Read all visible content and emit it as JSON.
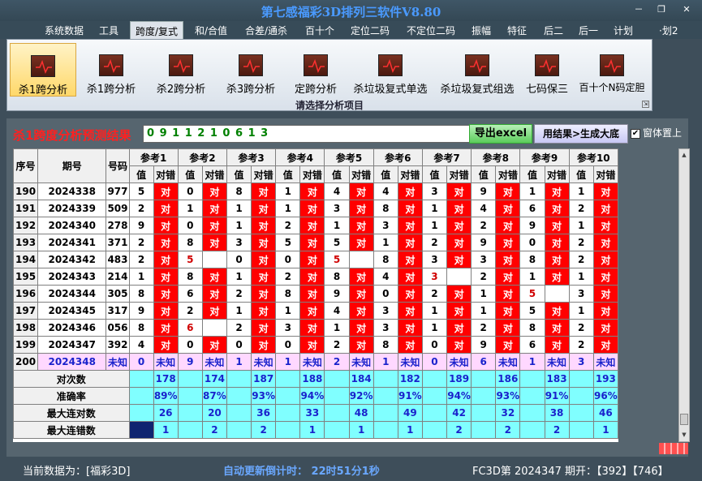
{
  "app": {
    "title": "第七感福彩3D排列三软件V8.80",
    "window_controls": [
      "－",
      "❐",
      "✕"
    ]
  },
  "menu": {
    "items": [
      "系统数据",
      "工具",
      "跨度/复式",
      "和/合值",
      "合差/通杀",
      "百十个",
      "定位二码",
      "不定位二码",
      "振幅",
      "特征",
      "后二",
      "后一",
      "计划",
      "·划2"
    ],
    "active": "跨度/复式"
  },
  "ribbon": {
    "caption": "请选择分析项目",
    "items": [
      "杀1跨分析",
      "杀1跨分析",
      "杀2跨分析",
      "杀3跨分析",
      "定跨分析",
      "杀垃圾复式单选",
      "杀垃圾复式组选",
      "七码保三",
      "百十个N码定胆"
    ],
    "selected_index": 0,
    "icon": "chart-icon"
  },
  "result": {
    "title": "杀1跨度分析预测结果",
    "value": "0 9 1 1 2 1 0 6 1 3",
    "export_button": "导出excel",
    "bigbase_button": "用结果>生成大底",
    "topmost_label": "窗体置上",
    "topmost_checked": true
  },
  "grid": {
    "headers": {
      "seq": "序号",
      "period": "期号",
      "number": "号码",
      "value": "值",
      "match": "对错"
    },
    "refs": [
      "参考1",
      "参考2",
      "参考3",
      "参考4",
      "参考5",
      "参考6",
      "参考7",
      "参考8",
      "参考9",
      "参考10"
    ],
    "rows": [
      {
        "seq": "190",
        "period": "2024338",
        "num": "977",
        "cells": [
          [
            "5",
            "对"
          ],
          [
            "0",
            "对"
          ],
          [
            "8",
            "对"
          ],
          [
            "1",
            "对"
          ],
          [
            "4",
            "对"
          ],
          [
            "4",
            "对"
          ],
          [
            "3",
            "对"
          ],
          [
            "9",
            "对"
          ],
          [
            "1",
            "对"
          ],
          [
            "1",
            "对"
          ]
        ]
      },
      {
        "seq": "191",
        "period": "2024339",
        "num": "509",
        "cells": [
          [
            "2",
            "对"
          ],
          [
            "1",
            "对"
          ],
          [
            "1",
            "对"
          ],
          [
            "1",
            "对"
          ],
          [
            "3",
            "对"
          ],
          [
            "8",
            "对"
          ],
          [
            "1",
            "对"
          ],
          [
            "4",
            "对"
          ],
          [
            "6",
            "对"
          ],
          [
            "2",
            "对"
          ]
        ]
      },
      {
        "seq": "192",
        "period": "2024340",
        "num": "278",
        "cells": [
          [
            "9",
            "对"
          ],
          [
            "0",
            "对"
          ],
          [
            "1",
            "对"
          ],
          [
            "2",
            "对"
          ],
          [
            "1",
            "对"
          ],
          [
            "3",
            "对"
          ],
          [
            "1",
            "对"
          ],
          [
            "2",
            "对"
          ],
          [
            "9",
            "对"
          ],
          [
            "1",
            "对"
          ]
        ]
      },
      {
        "seq": "193",
        "period": "2024341",
        "num": "371",
        "cells": [
          [
            "2",
            "对"
          ],
          [
            "8",
            "对"
          ],
          [
            "3",
            "对"
          ],
          [
            "5",
            "对"
          ],
          [
            "5",
            "对"
          ],
          [
            "1",
            "对"
          ],
          [
            "2",
            "对"
          ],
          [
            "9",
            "对"
          ],
          [
            "0",
            "对"
          ],
          [
            "2",
            "对"
          ]
        ]
      },
      {
        "seq": "194",
        "period": "2024342",
        "num": "483",
        "cells": [
          [
            "2",
            "对"
          ],
          [
            "5",
            ""
          ],
          [
            "0",
            "对"
          ],
          [
            "0",
            "对"
          ],
          [
            "5",
            ""
          ],
          [
            "8",
            "对"
          ],
          [
            "3",
            "对"
          ],
          [
            "3",
            "对"
          ],
          [
            "8",
            "对"
          ],
          [
            "2",
            "对"
          ]
        ]
      },
      {
        "seq": "195",
        "period": "2024343",
        "num": "214",
        "cells": [
          [
            "1",
            "对"
          ],
          [
            "8",
            "对"
          ],
          [
            "1",
            "对"
          ],
          [
            "2",
            "对"
          ],
          [
            "8",
            "对"
          ],
          [
            "4",
            "对"
          ],
          [
            "3",
            ""
          ],
          [
            "2",
            "对"
          ],
          [
            "1",
            "对"
          ],
          [
            "1",
            "对"
          ]
        ]
      },
      {
        "seq": "196",
        "period": "2024344",
        "num": "305",
        "cells": [
          [
            "8",
            "对"
          ],
          [
            "6",
            "对"
          ],
          [
            "2",
            "对"
          ],
          [
            "8",
            "对"
          ],
          [
            "9",
            "对"
          ],
          [
            "0",
            "对"
          ],
          [
            "2",
            "对"
          ],
          [
            "1",
            "对"
          ],
          [
            "5",
            ""
          ],
          [
            "3",
            "对"
          ]
        ]
      },
      {
        "seq": "197",
        "period": "2024345",
        "num": "317",
        "cells": [
          [
            "9",
            "对"
          ],
          [
            "2",
            "对"
          ],
          [
            "1",
            "对"
          ],
          [
            "1",
            "对"
          ],
          [
            "4",
            "对"
          ],
          [
            "3",
            "对"
          ],
          [
            "1",
            "对"
          ],
          [
            "1",
            "对"
          ],
          [
            "5",
            "对"
          ],
          [
            "1",
            "对"
          ]
        ]
      },
      {
        "seq": "198",
        "period": "2024346",
        "num": "056",
        "cells": [
          [
            "8",
            "对"
          ],
          [
            "6",
            ""
          ],
          [
            "2",
            "对"
          ],
          [
            "3",
            "对"
          ],
          [
            "1",
            "对"
          ],
          [
            "3",
            "对"
          ],
          [
            "1",
            "对"
          ],
          [
            "2",
            "对"
          ],
          [
            "8",
            "对"
          ],
          [
            "2",
            "对"
          ]
        ]
      },
      {
        "seq": "199",
        "period": "2024347",
        "num": "392",
        "cells": [
          [
            "4",
            "对"
          ],
          [
            "0",
            "对"
          ],
          [
            "0",
            "对"
          ],
          [
            "0",
            "对"
          ],
          [
            "2",
            "对"
          ],
          [
            "8",
            "对"
          ],
          [
            "0",
            "对"
          ],
          [
            "9",
            "对"
          ],
          [
            "6",
            "对"
          ],
          [
            "2",
            "对"
          ]
        ]
      }
    ],
    "pred_row": {
      "seq": "200",
      "period": "2024348",
      "num": "未知",
      "cells": [
        [
          "0",
          "未知"
        ],
        [
          "9",
          "未知"
        ],
        [
          "1",
          "未知"
        ],
        [
          "1",
          "未知"
        ],
        [
          "2",
          "未知"
        ],
        [
          "1",
          "未知"
        ],
        [
          "0",
          "未知"
        ],
        [
          "6",
          "未知"
        ],
        [
          "1",
          "未知"
        ],
        [
          "3",
          "未知"
        ]
      ]
    },
    "stats": [
      {
        "label": "对次数",
        "values": [
          "178",
          "174",
          "187",
          "188",
          "184",
          "182",
          "189",
          "186",
          "183",
          "193"
        ]
      },
      {
        "label": "准确率",
        "values": [
          "89%",
          "87%",
          "93%",
          "94%",
          "92%",
          "91%",
          "94%",
          "93%",
          "91%",
          "96%"
        ]
      },
      {
        "label": "最大连对数",
        "values": [
          "26",
          "20",
          "36",
          "33",
          "48",
          "49",
          "42",
          "32",
          "38",
          "46"
        ]
      },
      {
        "label": "最大连错数",
        "values": [
          "1",
          "2",
          "2",
          "1",
          "1",
          "1",
          "2",
          "2",
          "2",
          "1"
        ]
      }
    ],
    "colors": {
      "wrong_bg": "#ff0000",
      "pred_bg": "#ffd8ff",
      "stat_bg": "#80ffff",
      "stat_text": "#1a22cc",
      "hit_text": "#d00000"
    }
  },
  "status": {
    "current_data": "当前数据为：[福彩3D]",
    "timer": "自动更新倒计时：  22时51分1秒",
    "period": "FC3D第 2024347 期开：【392】【746】"
  }
}
